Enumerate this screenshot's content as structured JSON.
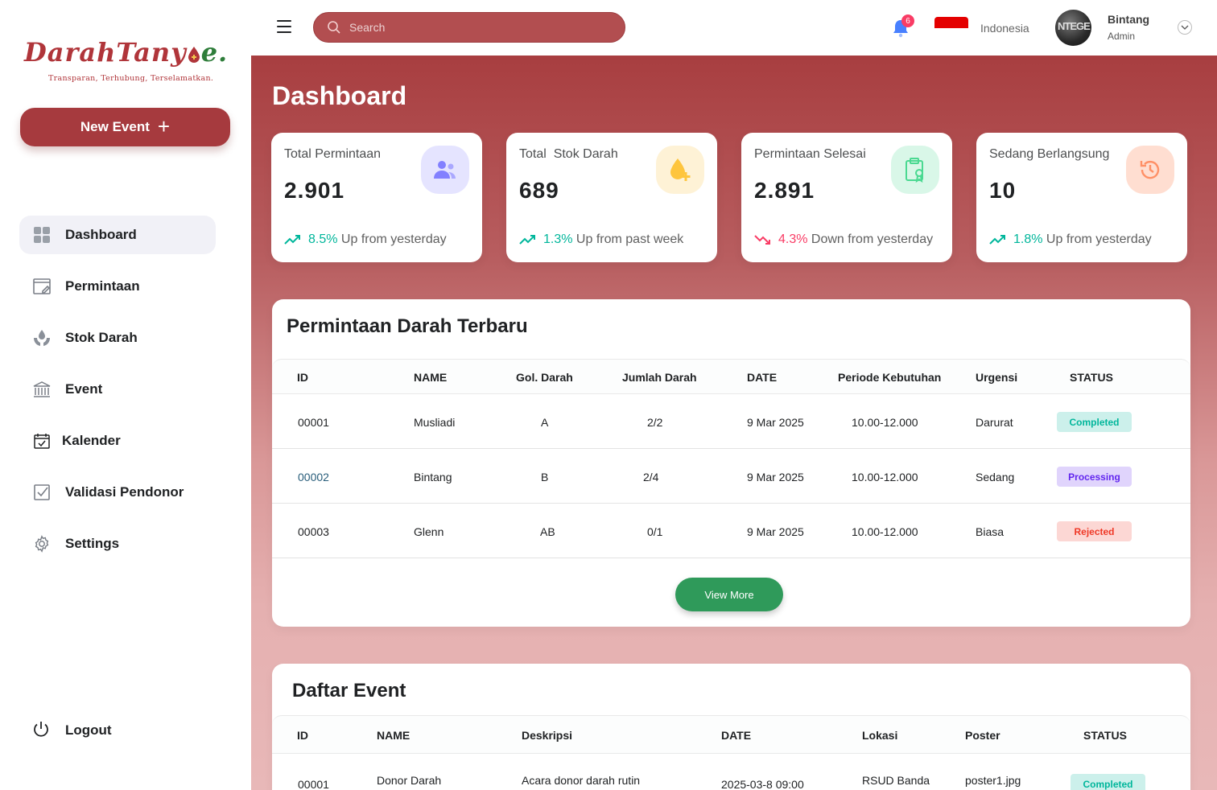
{
  "brand": {
    "logo_part1": "DarahTany",
    "logo_part2": "e.",
    "tagline": "Transparan, Terhubung, Terselamatkan."
  },
  "sidebar": {
    "new_event_label": "New Event",
    "items": [
      {
        "label": "Dashboard",
        "icon": "dashboard-grid-icon"
      },
      {
        "label": "Permintaan",
        "icon": "edit-document-icon"
      },
      {
        "label": "Stok Darah",
        "icon": "blood-hands-icon"
      },
      {
        "label": "Event",
        "icon": "building-icon"
      },
      {
        "label": "Kalender",
        "icon": "calendar-icon"
      },
      {
        "label": "Validasi Pendonor",
        "icon": "checkbox-icon"
      },
      {
        "label": "Settings",
        "icon": "gear-icon"
      }
    ],
    "logout_label": "Logout"
  },
  "topbar": {
    "search_placeholder": "Search",
    "notification_count": "6",
    "language": "Indonesia",
    "user_name": "Bintang",
    "user_role": "Admin",
    "avatar_text": "NTEGE"
  },
  "page_title": "Dashboard",
  "stats": [
    {
      "label": "Total Permintaan",
      "value": "2.901",
      "pct": "8.5%",
      "trend_text": "Up from yesterday",
      "direction": "up",
      "icon": "users-icon",
      "icon_bg": "#e5e4ff",
      "icon_color": "#8280ff"
    },
    {
      "label": "Total  Stok Darah",
      "value": "689",
      "pct": "1.3%",
      "trend_text": "Up from past week",
      "direction": "up",
      "icon": "blood-drop-plus-icon",
      "icon_bg": "#fef2d6",
      "icon_color": "#fec53d"
    },
    {
      "label": "Permintaan Selesai",
      "value": "2.891",
      "pct": "4.3%",
      "trend_text": "Down from yesterday",
      "direction": "down",
      "icon": "clipboard-icon",
      "icon_bg": "#d9f7e8",
      "icon_color": "#4ad991"
    },
    {
      "label": "Sedang Berlangsung",
      "value": "10",
      "pct": "1.8%",
      "trend_text": "Up from yesterday",
      "direction": "up",
      "icon": "history-icon",
      "icon_bg": "#ffded1",
      "icon_color": "#ff9066"
    }
  ],
  "requests": {
    "title": "Permintaan Darah Terbaru",
    "headers": [
      "ID",
      "NAME",
      "Gol. Darah",
      "Jumlah Darah",
      "DATE",
      "Periode Kebutuhan",
      "Urgensi",
      "STATUS"
    ],
    "rows": [
      {
        "id": "00001",
        "name": "Musliadi",
        "gol": "A",
        "jumlah": "2/2",
        "date": "9 Mar 2025",
        "periode": "10.00-12.000",
        "urgensi": "Darurat",
        "status": "Completed"
      },
      {
        "id": "00002",
        "name": "Bintang",
        "gol": "B",
        "jumlah": "2/4",
        "date": "9 Mar 2025",
        "periode": "10.00-12.000",
        "urgensi": "Sedang",
        "status": "Processing"
      },
      {
        "id": "00003",
        "name": "Glenn",
        "gol": "AB",
        "jumlah": "0/1",
        "date": "9 Mar 2025",
        "periode": "10.00-12.000",
        "urgensi": "Biasa",
        "status": "Rejected"
      }
    ],
    "view_more_label": "View More"
  },
  "events": {
    "title": "Daftar Event",
    "headers": [
      "ID",
      "NAME",
      "Deskripsi",
      "DATE",
      "Lokasi",
      "Poster",
      "STATUS"
    ],
    "rows": [
      {
        "id": "00001",
        "name": "Donor Darah",
        "deskripsi": "Acara donor darah rutin",
        "date": "2025-03-8 09:00",
        "lokasi": "RSUD Banda",
        "poster": "poster1.jpg",
        "status": "Completed"
      }
    ]
  },
  "colors": {
    "brand_red": "#a63a3e",
    "up": "#00b69b",
    "down": "#f93c65",
    "view_more": "#2f9a5a"
  }
}
